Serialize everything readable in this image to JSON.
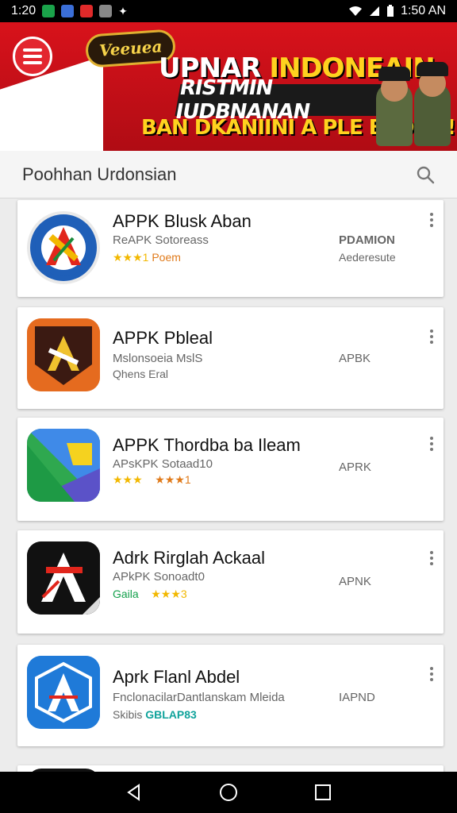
{
  "status_bar": {
    "time_left": "1:20",
    "time_right": "1:50 AN"
  },
  "banner": {
    "script_badge": "Veeuea",
    "title_part1": "UPNAR",
    "title_part2": "INDONEAIN",
    "ribbon_text": "RISTMIN IUDBNANAN",
    "subtitle": "BAN DKANIINI A PLE BEONH!"
  },
  "search": {
    "query": "Poohhan Urdonsian"
  },
  "apps": [
    {
      "name": "APPK Blusk Aban",
      "sub": "ReAPK Sotoreass",
      "meta_left": "★★★1",
      "meta_right": "Poem",
      "right_top": "PDAMION",
      "right_bottom": "Aederesute"
    },
    {
      "name": "APPK Pbleal",
      "sub": "Mslonsoeia MslS",
      "meta_left": "Qhens Eral",
      "meta_right": "",
      "right_top": "APBK",
      "right_bottom": ""
    },
    {
      "name": "APPK Thordba ba Ileam",
      "sub": "APsKPK Sotaad10",
      "meta_left": "★★★",
      "meta_right": "★★★1",
      "right_top": "APRK",
      "right_bottom": ""
    },
    {
      "name": "Adrk Rirglah Ackaal",
      "sub": "APkPK Sonoadt0",
      "meta_left": "Gaila",
      "meta_right": "★★★3",
      "right_top": "APNK",
      "right_bottom": ""
    },
    {
      "name": "Aprk Flanl Abdel",
      "sub": "FnclonacilarDantlanskam Mleida",
      "meta_left": "Skibis",
      "meta_right": "GBLAP83",
      "right_top": "IAPND",
      "right_bottom": ""
    }
  ],
  "colors": {
    "banner_red": "#d8121b",
    "accent_teal": "#10a39b",
    "star_yellow": "#f2b800"
  }
}
